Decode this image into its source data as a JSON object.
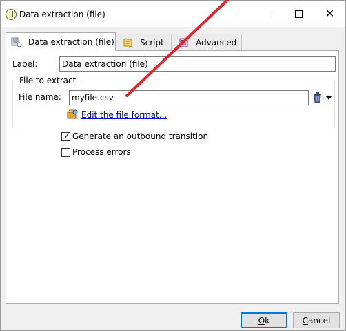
{
  "window": {
    "title": "Data extraction (file)",
    "controls": {
      "minimize": "minimize",
      "maximize": "maximize",
      "close": "✕"
    }
  },
  "tabs": [
    {
      "label": "Data extraction (file)",
      "icon": "data-extraction-icon",
      "active": true
    },
    {
      "label": "Script",
      "icon": "script-icon",
      "active": false
    },
    {
      "label": "Advanced",
      "icon": "advanced-icon",
      "active": false
    }
  ],
  "form": {
    "label_caption": "Label:",
    "label_value": "Data extraction (file)",
    "group_title": "File to extract",
    "file_name_caption": "File name:",
    "file_name_value": "myfile.csv",
    "edit_format_link": "Edit the file format...",
    "options": [
      {
        "label": "Generate an outbound transition",
        "checked": true
      },
      {
        "label": "Process errors",
        "checked": false
      }
    ]
  },
  "buttons": {
    "ok_first": "O",
    "ok_rest": "k",
    "cancel_first": "C",
    "cancel_rest": "ancel"
  },
  "colors": {
    "annotation": "#e8202a",
    "link": "#0000cc",
    "accent": "#0078d7"
  }
}
